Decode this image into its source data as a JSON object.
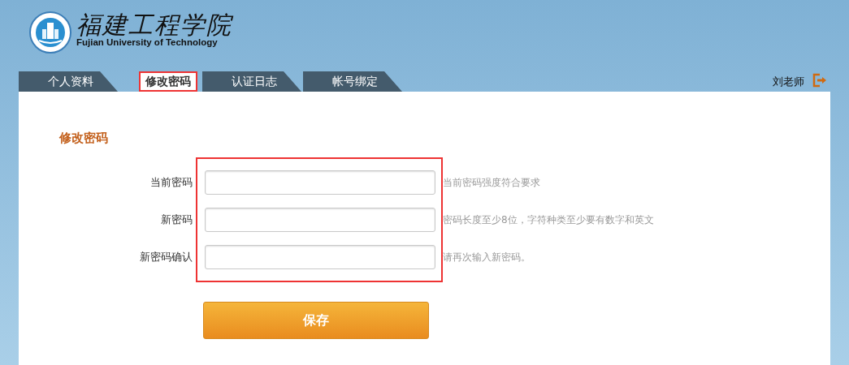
{
  "logo": {
    "name_cn": "福建工程学院",
    "name_en": "Fujian University of Technology"
  },
  "tabs": [
    {
      "label": "个人资料",
      "selected": false,
      "highlighted": false
    },
    {
      "label": "修改密码",
      "selected": true,
      "highlighted": true
    },
    {
      "label": "认证日志",
      "selected": false,
      "highlighted": false
    },
    {
      "label": "帐号绑定",
      "selected": false,
      "highlighted": false
    }
  ],
  "user": {
    "name": "刘老师"
  },
  "form": {
    "title": "修改密码",
    "highlighted": true,
    "fields": [
      {
        "label": "当前密码",
        "hint": "当前密码强度符合要求"
      },
      {
        "label": "新密码",
        "hint": "密码长度至少8位，字符种类至少要有数字和英文"
      },
      {
        "label": "新密码确认",
        "hint": "请再次输入新密码。"
      }
    ],
    "submit": "保存"
  }
}
